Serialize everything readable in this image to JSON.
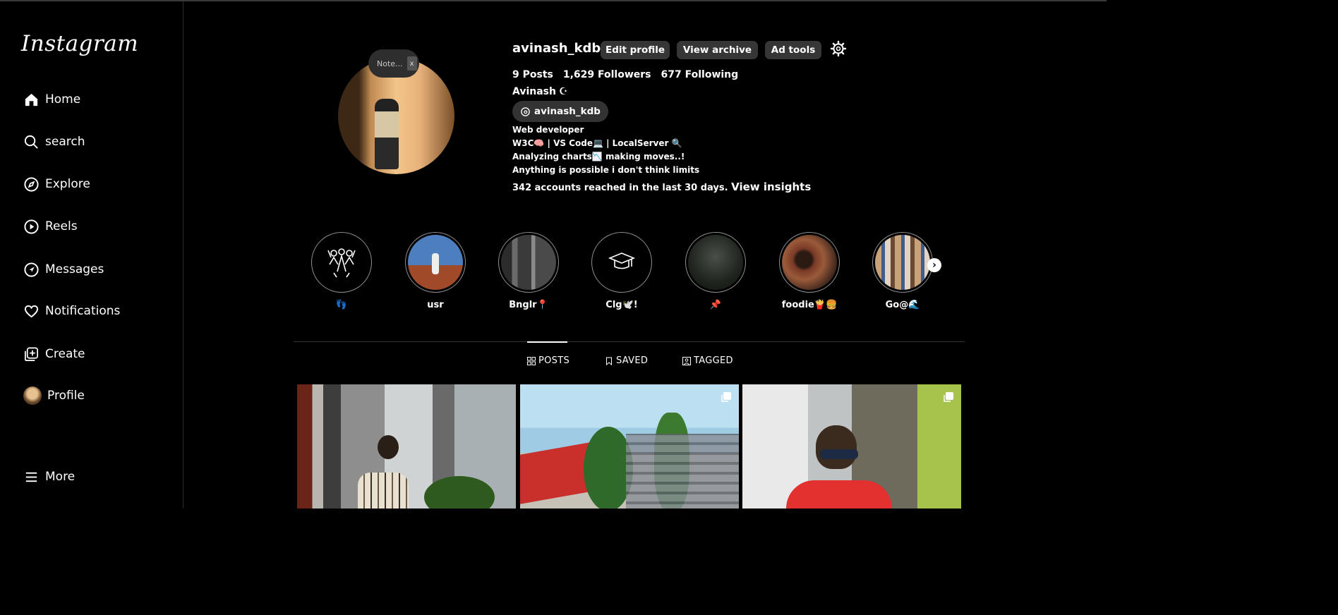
{
  "app": {
    "logo": "Instagram"
  },
  "sidebar": {
    "items": [
      {
        "label": "Home",
        "icon": "home-icon"
      },
      {
        "label": "search",
        "icon": "search-icon"
      },
      {
        "label": "Explore",
        "icon": "compass-icon"
      },
      {
        "label": "Reels",
        "icon": "play-circle-icon"
      },
      {
        "label": "Messages",
        "icon": "send-icon"
      },
      {
        "label": "Notifications",
        "icon": "heart-icon"
      },
      {
        "label": "Create",
        "icon": "plus-square-icon"
      },
      {
        "label": "Profile",
        "icon": "avatar"
      }
    ],
    "more": "More"
  },
  "note": {
    "text": "Note...",
    "close": "x"
  },
  "profile": {
    "username": "avinash_kdb",
    "buttons": {
      "edit": "Edit profile",
      "archive": "View archive",
      "adtools": "Ad tools"
    },
    "stats": {
      "posts": "9 Posts",
      "followers": "1,629 Followers",
      "following": "677 Following"
    },
    "full_name": "Avinash",
    "name_symbol": "☪",
    "threads_handle": "avinash_kdb",
    "bio": [
      "Web developer",
      "W3C🧠 | VS Code💻 | LocalServer 🔍",
      "Analyzing charts📉 making moves..!",
      "Anything is possible i don't think limits"
    ],
    "reach_text": "342 accounts reached in the last 30 days.",
    "insights_link": "View insights"
  },
  "highlights": [
    {
      "label": "👣"
    },
    {
      "label": "usr"
    },
    {
      "label": "Bnglr📍"
    },
    {
      "label": "Clg🕊️!"
    },
    {
      "label": "📌"
    },
    {
      "label": "foodie🍟🍔"
    },
    {
      "label": "Go@🌊"
    }
  ],
  "tabs": {
    "posts": "POSTS",
    "saved": "SAVED",
    "tagged": "TAGGED",
    "active": "POSTS"
  },
  "colors": {
    "background": "#000000",
    "button": "#363636",
    "divider": "#363636"
  }
}
